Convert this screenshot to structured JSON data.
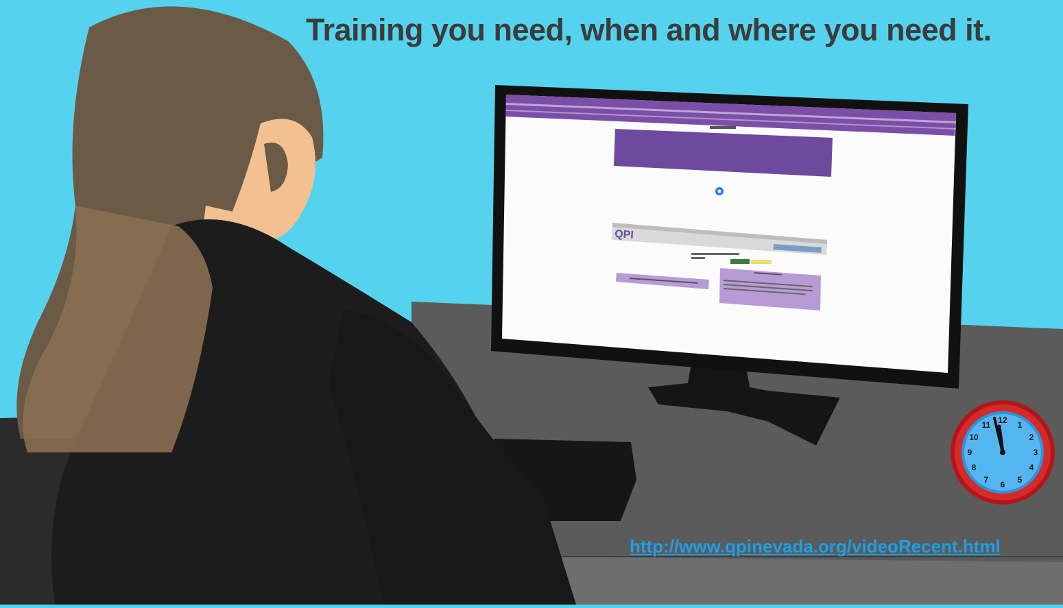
{
  "headline": "Training you need, when and where you need it.",
  "link": "http://www.qpinevada.org/videoRecent.html",
  "monitor_screen": {
    "logo_text": "QPI"
  },
  "clock": {
    "numerals": [
      "12",
      "1",
      "2",
      "3",
      "4",
      "5",
      "6",
      "7",
      "8",
      "9",
      "10",
      "11"
    ]
  },
  "colors": {
    "sky": "#55d3ee",
    "headline": "#3c3c3c",
    "link": "#1aa0e8",
    "purple": "#6e4a9e",
    "hair": "#6b5a46",
    "jacket": "#1c1c1c",
    "skin": "#f2c091",
    "desk": "#5a5a5a",
    "clock_red": "#c91f1f"
  }
}
